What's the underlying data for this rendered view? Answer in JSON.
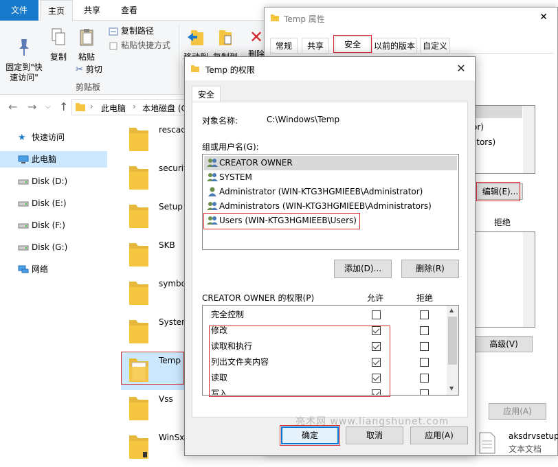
{
  "ribbon": {
    "tabs": [
      "文件",
      "主页",
      "共享",
      "查看"
    ],
    "pin_label": "固定到\"快\n速访问\"",
    "copy_label": "复制",
    "paste_label": "粘贴",
    "copy_path": "复制路径",
    "paste_shortcut": "粘贴快捷方式",
    "cut": "剪切",
    "group_clipboard": "剪贴板",
    "move_to": "移动到",
    "copy_to": "复制到",
    "delete": "删除"
  },
  "address": {
    "crumbs": [
      "此电脑",
      "本地磁盘 (C"
    ]
  },
  "nav": {
    "items": [
      "快速访问",
      "此电脑",
      "Disk (D:)",
      "Disk (E:)",
      "Disk (F:)",
      "Disk (G:)",
      "网络"
    ]
  },
  "files": {
    "items": [
      "rescach",
      "securit",
      "Setup",
      "SKB",
      "symbo",
      "System",
      "Temp",
      "Vss",
      "WinSxS"
    ],
    "bottom_right_name": "aksdrvsetup",
    "bottom_right_type": "文本文档"
  },
  "props": {
    "title": "Temp 属性",
    "tabs": [
      "常规",
      "共享",
      "安全",
      "以前的版本",
      "自定义"
    ],
    "list_partial_1": "rator)",
    "list_partial_2": "strators)",
    "edit_button": "编辑(E)...",
    "deny_header": "拒绝",
    "advanced_button": "高级(V)",
    "apply_button": "应用(A)"
  },
  "dialog": {
    "title": "Temp 的权限",
    "tab": "安全",
    "object_label": "对象名称:",
    "object_value": "C:\\Windows\\Temp",
    "group_label": "组或用户名(G):",
    "groups": [
      "CREATOR OWNER",
      "SYSTEM",
      "Administrator (WIN-KTG3HGMIEEB\\Administrator)",
      "Administrators (WIN-KTG3HGMIEEB\\Administrators)",
      "Users (WIN-KTG3HGMIEEB\\Users)"
    ],
    "add_button": "添加(D)...",
    "remove_button": "删除(R)",
    "perm_label": "CREATOR OWNER 的权限(P)",
    "allow_header": "允许",
    "deny_header": "拒绝",
    "permissions": [
      {
        "name": "完全控制",
        "allow": false,
        "deny": false
      },
      {
        "name": "修改",
        "allow": true,
        "deny": false
      },
      {
        "name": "读取和执行",
        "allow": true,
        "deny": false
      },
      {
        "name": "列出文件夹内容",
        "allow": true,
        "deny": false
      },
      {
        "name": "读取",
        "allow": true,
        "deny": false
      },
      {
        "name": "写入",
        "allow": true,
        "deny": false
      }
    ],
    "ok_button": "确定",
    "cancel_button": "取消",
    "apply_button": "应用(A)"
  },
  "watermark": "亮术网 www.liangshunet.com",
  "colors": {
    "accent": "#1979ca",
    "highlight": "#d9272e",
    "selection": "#cce8ff",
    "folder": "#f5c542"
  }
}
